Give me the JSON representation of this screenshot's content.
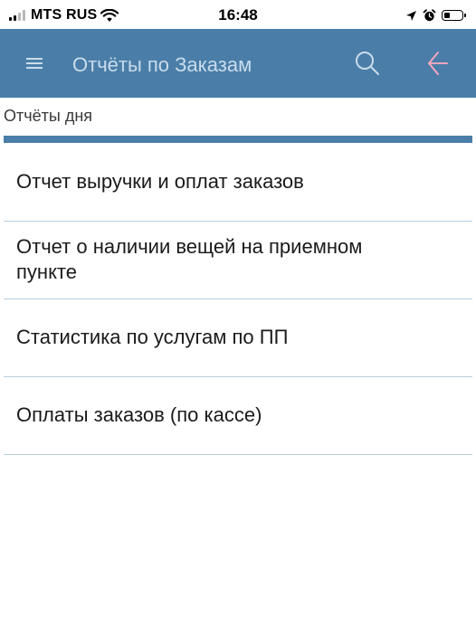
{
  "status_bar": {
    "carrier": "MTS RUS",
    "time": "16:48",
    "signal_bars_active": 2,
    "signal_bars_total": 4,
    "battery_level": 0.3,
    "icons": [
      "signal-icon",
      "wifi-icon",
      "location-arrow-icon",
      "alarm-icon",
      "battery-icon"
    ]
  },
  "app_bar": {
    "title": "Отчёты по Заказам",
    "color": "#4a7ea8",
    "title_color": "#c9dcec",
    "icons": {
      "menu": "hamburger-menu-icon",
      "search": "search-icon",
      "back": "back-arrow-icon"
    },
    "back_icon_color": "#f4a6c0"
  },
  "section": {
    "title": "Отчёты дня"
  },
  "reports": [
    {
      "label": "Отчет выручки и оплат заказов"
    },
    {
      "label": "Отчет о наличии вещей на приемном пункте"
    },
    {
      "label": "Статистика по услугам по ПП"
    },
    {
      "label": "Оплаты заказов (по кассе)"
    }
  ]
}
